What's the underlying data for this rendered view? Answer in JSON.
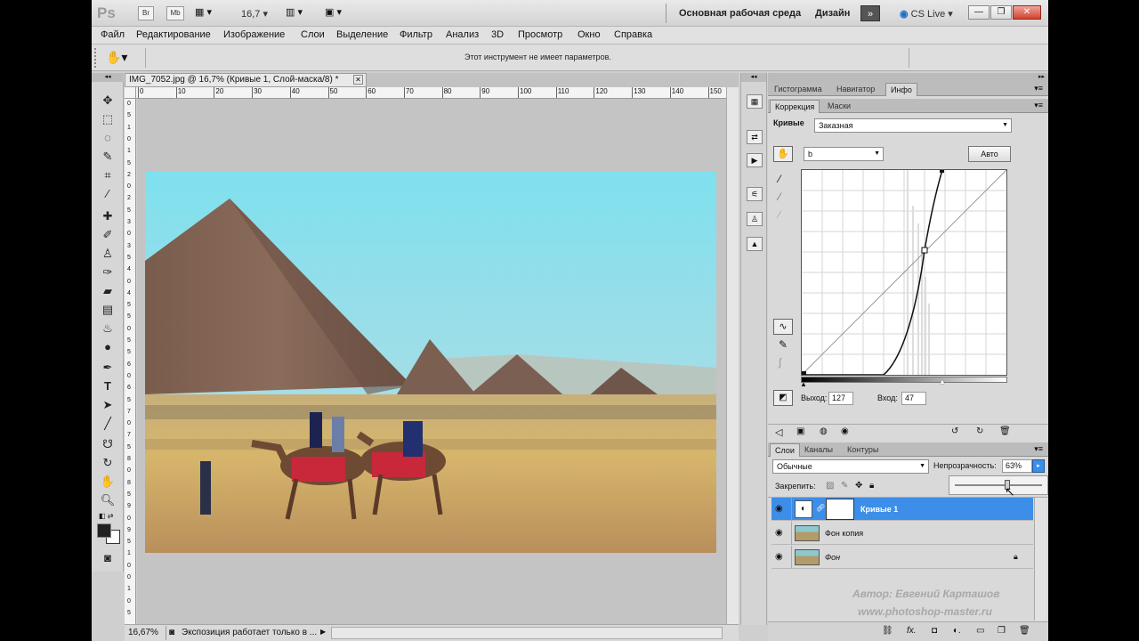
{
  "app": {
    "logo": "Ps",
    "bridge_btn": "Br",
    "minibridge_btn": "Mb",
    "zoom_value": "16,7",
    "workspace_main": "Основная рабочая среда",
    "workspace_design": "Дизайн",
    "cs_live": "CS Live"
  },
  "menu": [
    "Файл",
    "Редактирование",
    "Изображение",
    "Слои",
    "Выделение",
    "Фильтр",
    "Анализ",
    "3D",
    "Просмотр",
    "Окно",
    "Справка"
  ],
  "options": {
    "message": "Этот инструмент не имеет параметров."
  },
  "document": {
    "tab_title": "IMG_7052.jpg @ 16,7% (Кривые 1, Слой-маска/8) *",
    "ruler_h": [
      "0",
      "10",
      "20",
      "30",
      "40",
      "50",
      "60",
      "70",
      "80",
      "90",
      "100",
      "110",
      "120",
      "130",
      "140",
      "150"
    ],
    "ruler_v": [
      "0",
      "5",
      "1",
      "0",
      "1",
      "5",
      "2",
      "0",
      "2",
      "5",
      "3",
      "0",
      "3",
      "5",
      "4",
      "0",
      "4",
      "5",
      "5",
      "0",
      "5",
      "5",
      "6",
      "0",
      "6",
      "5",
      "7",
      "0",
      "7",
      "5",
      "8",
      "0",
      "8",
      "5",
      "9",
      "0",
      "9",
      "5",
      "1",
      "0",
      "0",
      "1",
      "0",
      "5"
    ],
    "zoom": "16,67%",
    "status": "Экспозиция работает только в ..."
  },
  "panels": {
    "top_tabs": [
      "Гистограмма",
      "Навигатор",
      "Инфо"
    ],
    "adjust_tabs": [
      "Коррекция",
      "Маски"
    ],
    "curves_label": "Кривые",
    "preset": "Заказная",
    "channel": "b",
    "auto_btn": "Авто",
    "output_label": "Выход:",
    "output_value": "127",
    "input_label": "Вход:",
    "input_value": "47",
    "layers_tabs": [
      "Слои",
      "Каналы",
      "Контуры"
    ],
    "blend_mode": "Обычные",
    "opacity_label": "Непрозрачность:",
    "opacity_value": "63%",
    "lock_label": "Закрепить:",
    "layers": [
      {
        "name": "Кривые 1",
        "selected": true
      },
      {
        "name": "Фон копия",
        "selected": false
      },
      {
        "name": "Фон",
        "selected": false,
        "locked": true
      }
    ]
  },
  "watermark": {
    "author": "Автор: Евгений Карташов",
    "site": "www.photoshop-master.ru"
  },
  "colors": {
    "accent": "#3d8ee8",
    "selected_layer": "#3d8ee8"
  }
}
